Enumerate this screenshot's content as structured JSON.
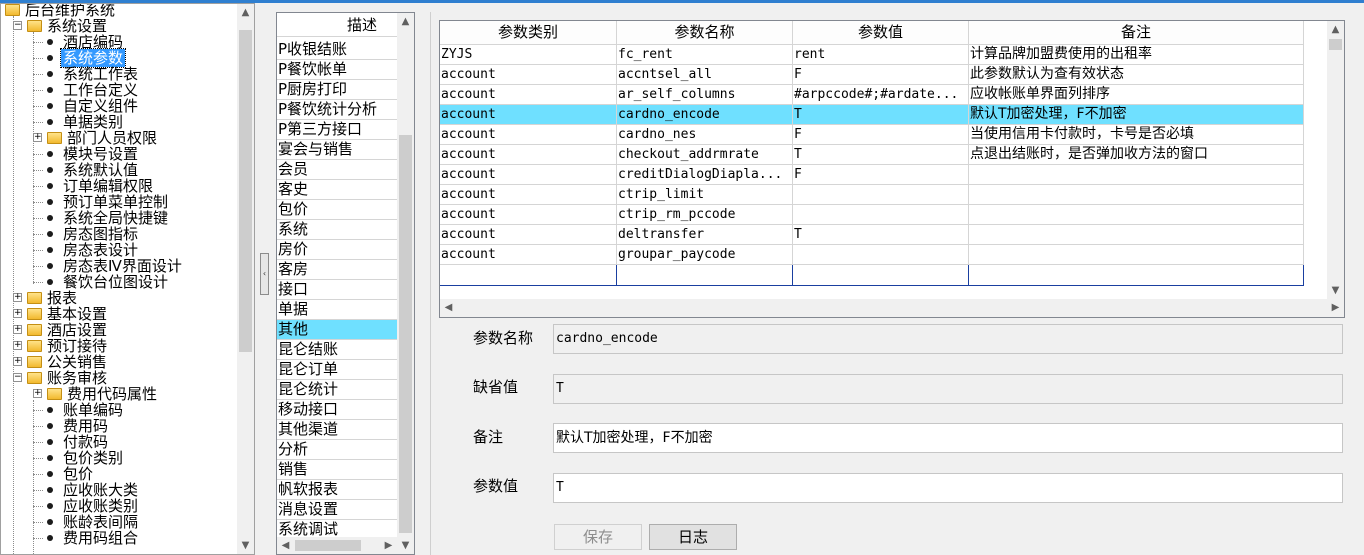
{
  "tree": {
    "root": "后台维护系统",
    "items": [
      {
        "label": "系统设置",
        "level": 1,
        "kind": "folder",
        "expanded": true
      },
      {
        "label": "酒店编码",
        "level": 2,
        "kind": "leaf"
      },
      {
        "label": "系统参数",
        "level": 2,
        "kind": "leaf",
        "selected": true
      },
      {
        "label": "系统工作表",
        "level": 2,
        "kind": "leaf"
      },
      {
        "label": "工作台定义",
        "level": 2,
        "kind": "leaf"
      },
      {
        "label": "自定义组件",
        "level": 2,
        "kind": "leaf"
      },
      {
        "label": "单据类别",
        "level": 2,
        "kind": "leaf"
      },
      {
        "label": "部门人员权限",
        "level": 2,
        "kind": "folder",
        "expanded": false
      },
      {
        "label": "模块号设置",
        "level": 2,
        "kind": "leaf"
      },
      {
        "label": "系统默认值",
        "level": 2,
        "kind": "leaf"
      },
      {
        "label": "订单编辑权限",
        "level": 2,
        "kind": "leaf"
      },
      {
        "label": "预订单菜单控制",
        "level": 2,
        "kind": "leaf"
      },
      {
        "label": "系统全局快捷键",
        "level": 2,
        "kind": "leaf"
      },
      {
        "label": "房态图指标",
        "level": 2,
        "kind": "leaf"
      },
      {
        "label": "房态表设计",
        "level": 2,
        "kind": "leaf"
      },
      {
        "label": "房态表Ⅳ界面设计",
        "level": 2,
        "kind": "leaf"
      },
      {
        "label": "餐饮台位图设计",
        "level": 2,
        "kind": "leaf"
      },
      {
        "label": "报表",
        "level": 1,
        "kind": "folder",
        "expanded": false
      },
      {
        "label": "基本设置",
        "level": 1,
        "kind": "folder",
        "expanded": false
      },
      {
        "label": "酒店设置",
        "level": 1,
        "kind": "folder",
        "expanded": false
      },
      {
        "label": "预订接待",
        "level": 1,
        "kind": "folder",
        "expanded": false
      },
      {
        "label": "公关销售",
        "level": 1,
        "kind": "folder",
        "expanded": false
      },
      {
        "label": "账务审核",
        "level": 1,
        "kind": "folder",
        "expanded": true
      },
      {
        "label": "费用代码属性",
        "level": 2,
        "kind": "folder",
        "expanded": false
      },
      {
        "label": "账单编码",
        "level": 2,
        "kind": "leaf"
      },
      {
        "label": "费用码",
        "level": 2,
        "kind": "leaf"
      },
      {
        "label": "付款码",
        "level": 2,
        "kind": "leaf"
      },
      {
        "label": "包价类别",
        "level": 2,
        "kind": "leaf"
      },
      {
        "label": "包价",
        "level": 2,
        "kind": "leaf"
      },
      {
        "label": "应收账大类",
        "level": 2,
        "kind": "leaf"
      },
      {
        "label": "应收账类别",
        "level": 2,
        "kind": "leaf"
      },
      {
        "label": "账龄表间隔",
        "level": 2,
        "kind": "leaf"
      },
      {
        "label": "费用码组合",
        "level": 2,
        "kind": "leaf"
      }
    ]
  },
  "categories": {
    "header": "描述",
    "items": [
      "P收银结账",
      "P餐饮帐单",
      "P厨房打印",
      "P餐饮统计分析",
      "P第三方接口",
      "宴会与销售",
      "会员",
      "客史",
      "包价",
      "系统",
      "房价",
      "客房",
      "接口",
      "单据",
      "其他",
      "昆仑结账",
      "昆仑订单",
      "昆仑统计",
      "移动接口",
      "其他渠道",
      "分析",
      "销售",
      "帆软报表",
      "消息设置",
      "系统调试"
    ],
    "selected_index": 14
  },
  "grid": {
    "headers": [
      "参数类别",
      "参数名称",
      "参数值",
      "备注"
    ],
    "rows": [
      [
        "ZYJS",
        "fc_rent",
        "rent",
        "计算品牌加盟费使用的出租率"
      ],
      [
        "account",
        "accntsel_all",
        "F",
        "此参数默认为查有效状态"
      ],
      [
        "account",
        "ar_self_columns",
        "#arpccode#;#ardate...",
        "应收帐账单界面列排序"
      ],
      [
        "account",
        "cardno_encode",
        "T",
        "默认T加密处理，F不加密"
      ],
      [
        "account",
        "cardno_nes",
        "F",
        "当使用信用卡付款时，卡号是否必填"
      ],
      [
        "account",
        "checkout_addrmrate",
        "T",
        "点退出结账时，是否弹加收方法的窗口"
      ],
      [
        "account",
        "creditDialogDiapla...",
        "F",
        ""
      ],
      [
        "account",
        "ctrip_limit",
        "",
        ""
      ],
      [
        "account",
        "ctrip_rm_pccode",
        "",
        ""
      ],
      [
        "account",
        "deltransfer",
        "T",
        ""
      ],
      [
        "account",
        "groupar_paycode",
        "",
        ""
      ]
    ],
    "selected_index": 3
  },
  "form": {
    "name_label": "参数名称",
    "name_value": "cardno_encode",
    "default_label": "缺省值",
    "default_value": "T",
    "remark_label": "备注",
    "remark_value": "默认T加密处理，F不加密",
    "value_label": "参数值",
    "value_value": "T",
    "save_label": "保存",
    "log_label": "日志"
  },
  "colors": {
    "selection": "#6fe0ff",
    "tree_selection": "#3399ff"
  }
}
